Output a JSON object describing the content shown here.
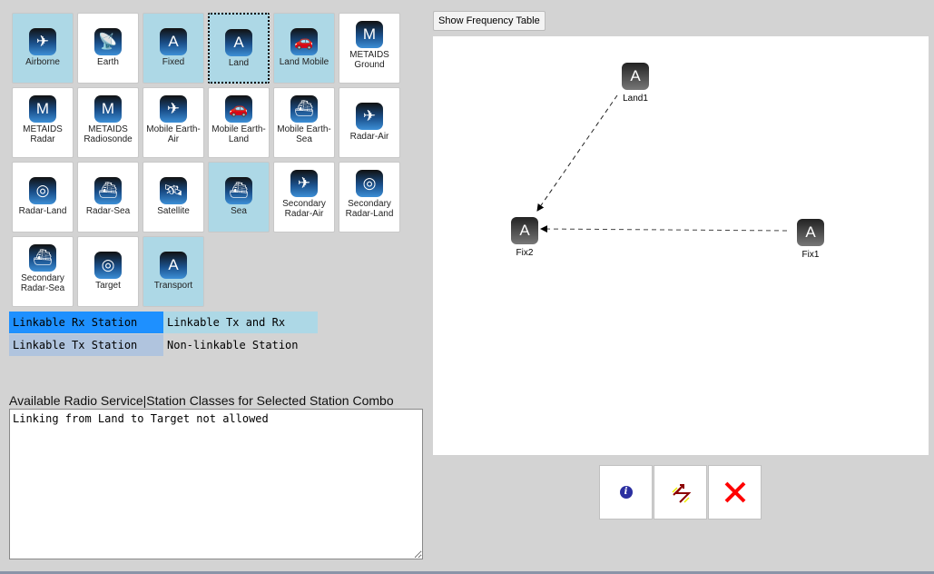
{
  "stations": [
    {
      "label": "Airborne",
      "icon": "airplane-icon",
      "glyph": "✈",
      "state": "linkable-tx-rx"
    },
    {
      "label": "Earth",
      "icon": "satellite-dish-icon",
      "glyph": "📡",
      "state": "non-linkable"
    },
    {
      "label": "Fixed",
      "icon": "antenna-tower-icon",
      "glyph": "A",
      "state": "linkable-tx-rx"
    },
    {
      "label": "Land",
      "icon": "land-station-icon",
      "glyph": "A",
      "state": "selected"
    },
    {
      "label": "Land Mobile",
      "icon": "car-icon",
      "glyph": "🚗",
      "state": "linkable-tx-rx"
    },
    {
      "label": "METAIDS Ground",
      "icon": "metaids-ground-icon",
      "glyph": "M",
      "state": "non-linkable"
    },
    {
      "label": "METAIDS Radar",
      "icon": "metaids-radar-icon",
      "glyph": "M",
      "state": "non-linkable"
    },
    {
      "label": "METAIDS Radiosonde",
      "icon": "balloon-icon",
      "glyph": "M",
      "state": "non-linkable"
    },
    {
      "label": "Mobile Earth-Air",
      "icon": "mobile-earth-air-icon",
      "glyph": "✈",
      "state": "non-linkable"
    },
    {
      "label": "Mobile Earth-Land",
      "icon": "mobile-earth-land-icon",
      "glyph": "🚗",
      "state": "non-linkable"
    },
    {
      "label": "Mobile Earth-Sea",
      "icon": "mobile-earth-sea-icon",
      "glyph": "⛴",
      "state": "non-linkable"
    },
    {
      "label": "Radar-Air",
      "icon": "radar-air-icon",
      "glyph": "✈",
      "state": "non-linkable"
    },
    {
      "label": "Radar-Land",
      "icon": "radar-land-icon",
      "glyph": "◎",
      "state": "non-linkable"
    },
    {
      "label": "Radar-Sea",
      "icon": "radar-sea-icon",
      "glyph": "⛴",
      "state": "non-linkable"
    },
    {
      "label": "Satellite",
      "icon": "satellite-icon",
      "glyph": "🛰",
      "state": "non-linkable"
    },
    {
      "label": "Sea",
      "icon": "ship-icon",
      "glyph": "⛴",
      "state": "linkable-tx-rx"
    },
    {
      "label": "Secondary Radar-Air",
      "icon": "secondary-radar-air-icon",
      "glyph": "✈",
      "state": "non-linkable"
    },
    {
      "label": "Secondary Radar-Land",
      "icon": "secondary-radar-land-icon",
      "glyph": "◎",
      "state": "non-linkable"
    },
    {
      "label": "Secondary Radar-Sea",
      "icon": "secondary-radar-sea-icon",
      "glyph": "⛴",
      "state": "non-linkable"
    },
    {
      "label": "Target",
      "icon": "target-icon",
      "glyph": "◎",
      "state": "non-linkable"
    },
    {
      "label": "Transport",
      "icon": "transport-icon",
      "glyph": "A",
      "state": "linkable-tx-rx"
    }
  ],
  "legend": [
    {
      "label": "Linkable Rx Station",
      "color": "#1e90ff"
    },
    {
      "label": "Linkable Tx and Rx",
      "color": "#add8e6"
    },
    {
      "label": "Linkable Tx Station",
      "color": "#b0c4de"
    },
    {
      "label": "Non-linkable Station",
      "color": "#d3d3d3"
    }
  ],
  "services": {
    "label": "Available Radio Service|Station Classes for Selected Station Combo",
    "value": "Linking from Land to Target not allowed"
  },
  "show_frequency_table": "Show Frequency Table",
  "diagram": {
    "nodes": [
      {
        "label": "Land1",
        "icon": "land-station-icon"
      },
      {
        "label": "Fix2",
        "icon": "fixed-station-icon"
      },
      {
        "label": "Fix1",
        "icon": "fixed-station-icon"
      }
    ],
    "links": [
      {
        "from": "Land1",
        "to": "Fix2"
      },
      {
        "from": "Fix1",
        "to": "Fix2"
      }
    ]
  },
  "actions": [
    {
      "name": "info",
      "icon": "info-icon"
    },
    {
      "name": "link",
      "icon": "link-lightning-icon"
    },
    {
      "name": "delete",
      "icon": "close-icon"
    }
  ]
}
